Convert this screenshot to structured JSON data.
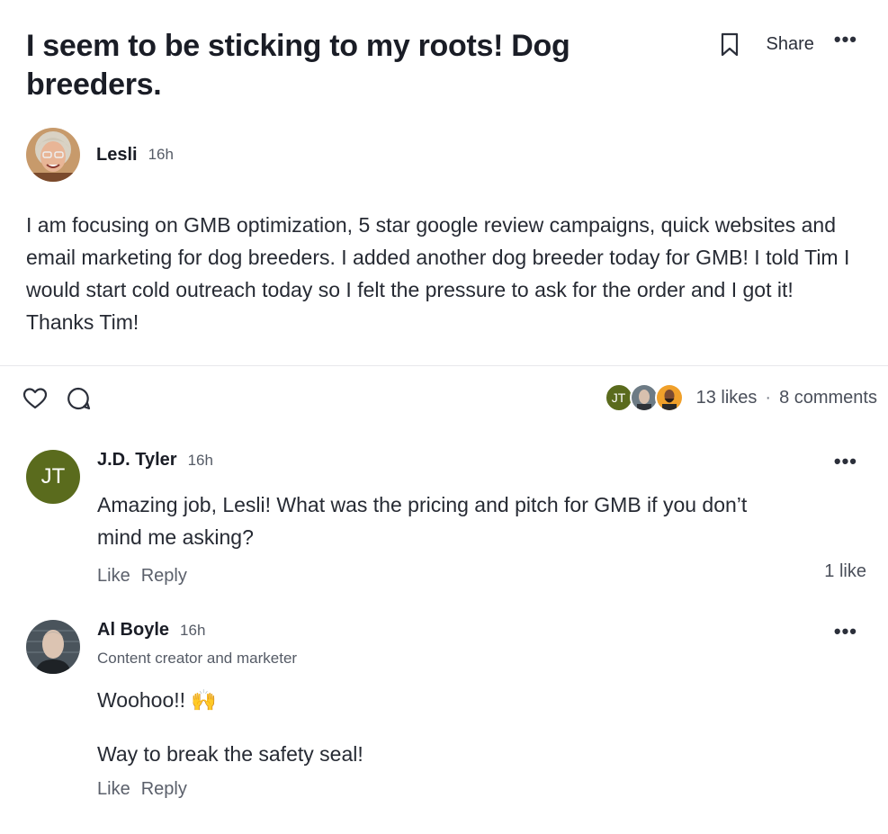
{
  "post": {
    "title": "I seem to be sticking to my roots! Dog breeders.",
    "share_label": "Share",
    "more_label": "•••",
    "author": "Lesli",
    "time": "16h",
    "body": "I am focusing on GMB optimization, 5 star google review campaigns, quick websites and email marketing for dog breeders.  I added another dog breeder today for GMB!  I told Tim I would start cold outreach today so I felt the pressure to ask for the order and I got it!  Thanks Tim!"
  },
  "stats": {
    "avatar_initials": "JT",
    "likes": "13 likes",
    "separator": "·",
    "comments": "8 comments"
  },
  "comments": [
    {
      "initials": "JT",
      "name": "J.D. Tyler",
      "time": "16h",
      "text": "Amazing job, Lesli! What was the pricing and pitch for GMB if you don’t mind me asking?",
      "like": "Like",
      "reply": "Reply",
      "likes": "1 like",
      "more": "•••"
    },
    {
      "name": "Al Boyle",
      "time": "16h",
      "subtitle": "Content creator and marketer",
      "text1": "Woohoo!! 🙌",
      "text2": "Way to break the safety seal!",
      "like": "Like",
      "reply": "Reply",
      "more": "•••"
    }
  ],
  "colors": {
    "jt_avatar": "#5a6b1d",
    "orange_avatar": "#f0a02a"
  },
  "icons": [
    "bookmark-icon",
    "heart-icon",
    "comment-icon"
  ]
}
